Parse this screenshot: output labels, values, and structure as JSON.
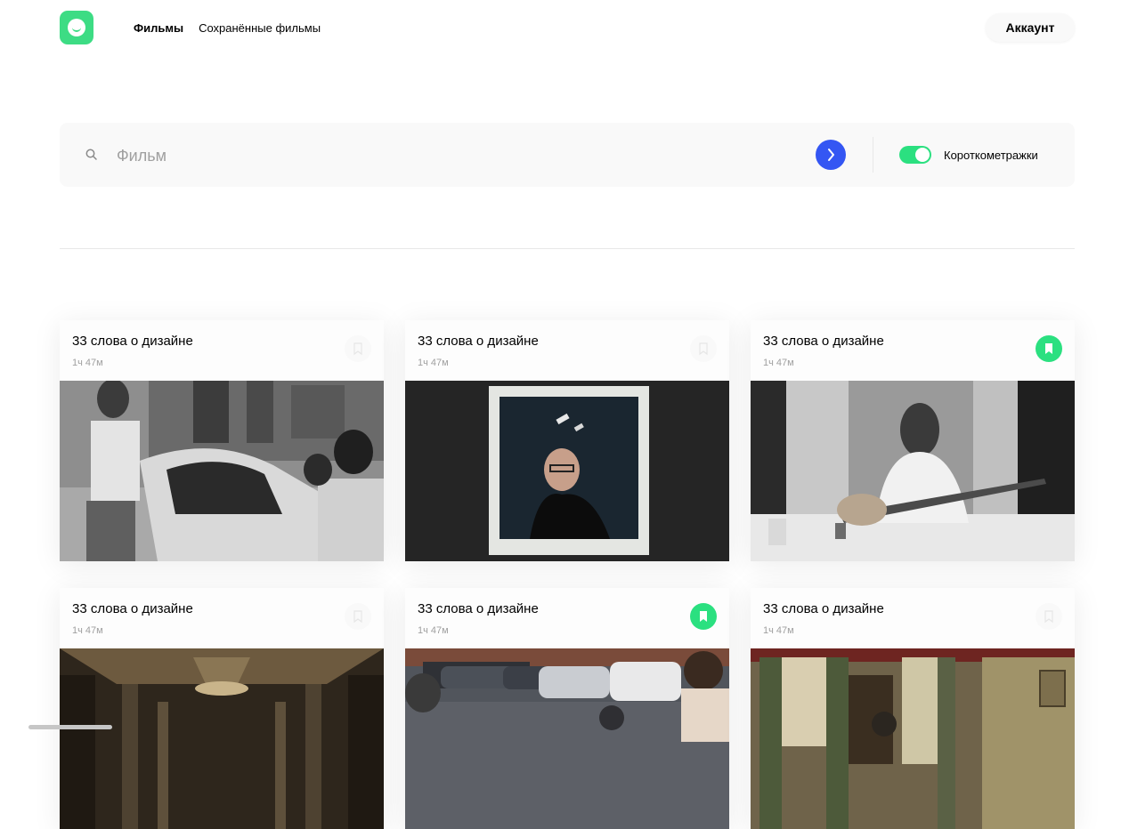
{
  "header": {
    "logo_icon": "smile-logo-icon",
    "nav": [
      {
        "label": "Фильмы",
        "active": true
      },
      {
        "label": "Сохранённые фильмы",
        "active": false
      }
    ],
    "account_label": "Аккаунт"
  },
  "search": {
    "placeholder": "Фильм",
    "value": "",
    "submit_icon": "chevron-right-icon",
    "short_films_label": "Короткометражки",
    "short_films_on": true
  },
  "colors": {
    "accent_green": "#2be080",
    "button_blue": "#3456f3"
  },
  "cards": [
    {
      "title": "33 слова о дизайне",
      "duration": "1ч 47м",
      "saved": false,
      "image": "street-photographer-bw"
    },
    {
      "title": "33 слова о дизайне",
      "duration": "1ч 47м",
      "saved": false,
      "image": "polaroid-portrait"
    },
    {
      "title": "33 слова о дизайне",
      "duration": "1ч 47м",
      "saved": true,
      "image": "guitarist-bw"
    },
    {
      "title": "33 слова о дизайне",
      "duration": "1ч 47м",
      "saved": false,
      "image": "grand-hall-interior"
    },
    {
      "title": "33 слова о дизайне",
      "duration": "1ч 47м",
      "saved": true,
      "image": "street-with-cars"
    },
    {
      "title": "33 слова о дизайне",
      "duration": "1ч 47м",
      "saved": false,
      "image": "room-interior"
    }
  ]
}
